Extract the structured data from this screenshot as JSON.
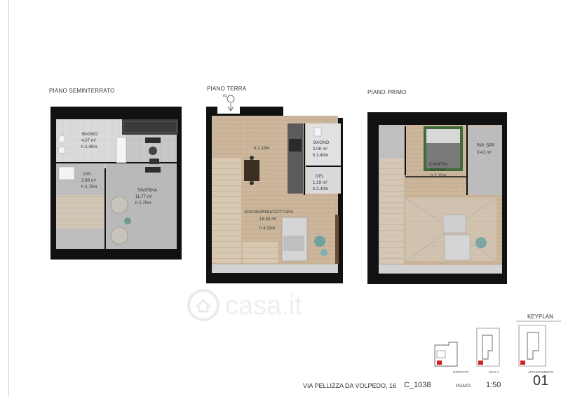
{
  "floors": {
    "seminterrato": {
      "title": "PIANO SEMINTERRATO",
      "rooms": [
        {
          "name": "BAGNO",
          "area": "4.07 m²",
          "height": "h 2.40m"
        },
        {
          "name": "DIS",
          "area": "3.98 m²",
          "height": "h 2.70m"
        },
        {
          "name": "TAVERNA",
          "area": "11.77 m²",
          "height": "h 2.70m"
        }
      ]
    },
    "terra": {
      "title": "PIANO TERRA",
      "entry_marker": "01",
      "rooms": [
        {
          "name": "",
          "area": "",
          "height": "h 2.10m"
        },
        {
          "name": "BAGNO",
          "area": "2.06 m²",
          "height": "h 2.40m"
        },
        {
          "name": "DIS.",
          "area": "1.19 m²",
          "height": "h 2.40m"
        },
        {
          "name": "SOGGIORNO/COTTURA",
          "area": "18.53 m²",
          "height": "h 4.33m"
        }
      ]
    },
    "primo": {
      "title": "PIANO PRIMO",
      "rooms": [
        {
          "name": "RIP. SPP",
          "area": "3.41 m²",
          "height": ""
        },
        {
          "name": "CAMERA",
          "area": "6.09 m²",
          "height": "h 2.10m"
        }
      ]
    }
  },
  "footer": {
    "address": "VIA PELLIZZA DA VOLPEDO, 16",
    "code": "C_1038",
    "pianta_label": "PIANTA",
    "scale": "1:50",
    "keyplan_label": "KEYPLAN",
    "oggetto_label": "OGGETTO",
    "scala_label": "SCALA",
    "appartamento_label": "APPARTAMENTO",
    "appartamento_number": "01"
  },
  "watermark": {
    "text": "casa.it"
  },
  "colors": {
    "wall": "#1a1a1a",
    "wood": "#c9b49a",
    "tile": "#c3c3c3",
    "accent_green": "#3f6b3a",
    "keyplan_red": "#d42020"
  }
}
